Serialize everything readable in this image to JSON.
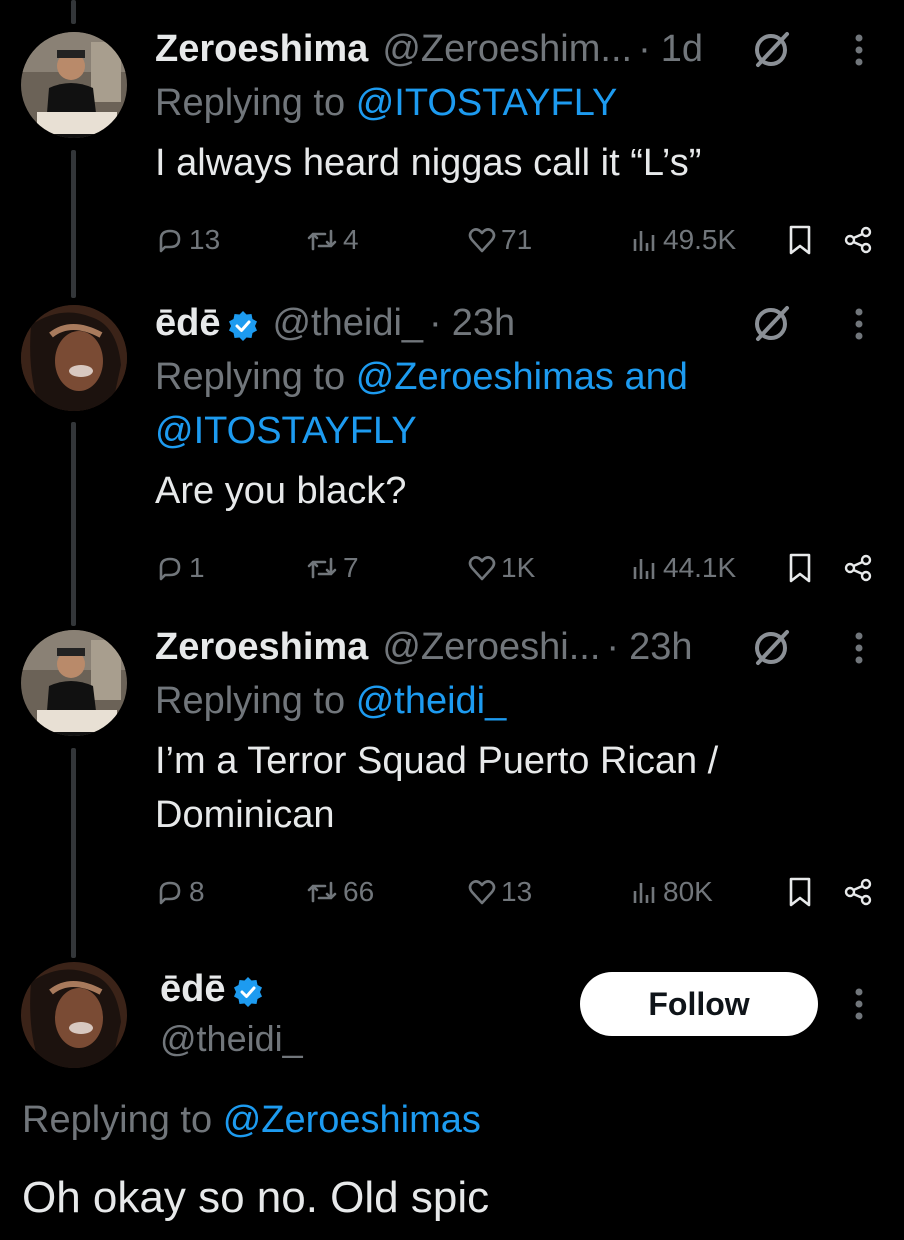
{
  "colors": {
    "background": "#000000",
    "text": "#e7e9ea",
    "muted": "#71767b",
    "accent": "#1d9bf0",
    "thread_line": "#333639"
  },
  "replies": [
    {
      "display_name": "Zeroeshima",
      "handle": "@Zeroeshim...",
      "dot": "·",
      "time": "1d",
      "verified": false,
      "avatar_icon": "user-avatar",
      "replying_prefix": "Replying to",
      "replying_to": "@ITOSTAYFLY",
      "text": "I always heard niggas call it “L’s”",
      "stats": {
        "replies": "13",
        "reposts": "4",
        "likes": "71",
        "views": "49.5K"
      }
    },
    {
      "display_name": "ēdē",
      "handle": "@theidi_",
      "dot": "·",
      "time": "23h",
      "verified": true,
      "avatar_icon": "user-avatar",
      "replying_prefix": "Replying to",
      "replying_to": "@Zeroeshimas and",
      "replying_to_2": "@ITOSTAYFLY",
      "text": "Are you black?",
      "stats": {
        "replies": "1",
        "reposts": "7",
        "likes": "1K",
        "views": "44.1K"
      }
    },
    {
      "display_name": "Zeroeshima",
      "handle": "@Zeroeshi...",
      "dot": "·",
      "time": "23h",
      "verified": false,
      "avatar_icon": "user-avatar",
      "replying_prefix": "Replying to",
      "replying_to": "@theidi_",
      "text_line1": "I’m a Terror Squad Puerto Rican /",
      "text_line2": "Dominican",
      "stats": {
        "replies": "8",
        "reposts": "66",
        "likes": "13",
        "views": "80K"
      }
    }
  ],
  "main_tweet": {
    "display_name": "ēdē",
    "handle": "@theidi_",
    "verified": true,
    "follow_label": "Follow",
    "replying_prefix": "Replying to",
    "replying_to": "@Zeroeshimas",
    "text": "Oh okay so no. Old spic"
  },
  "icons": [
    "reply-icon",
    "repost-icon",
    "like-icon",
    "views-icon",
    "bookmark-icon",
    "share-icon",
    "grok-icon",
    "more-icon",
    "verified-badge-icon"
  ]
}
